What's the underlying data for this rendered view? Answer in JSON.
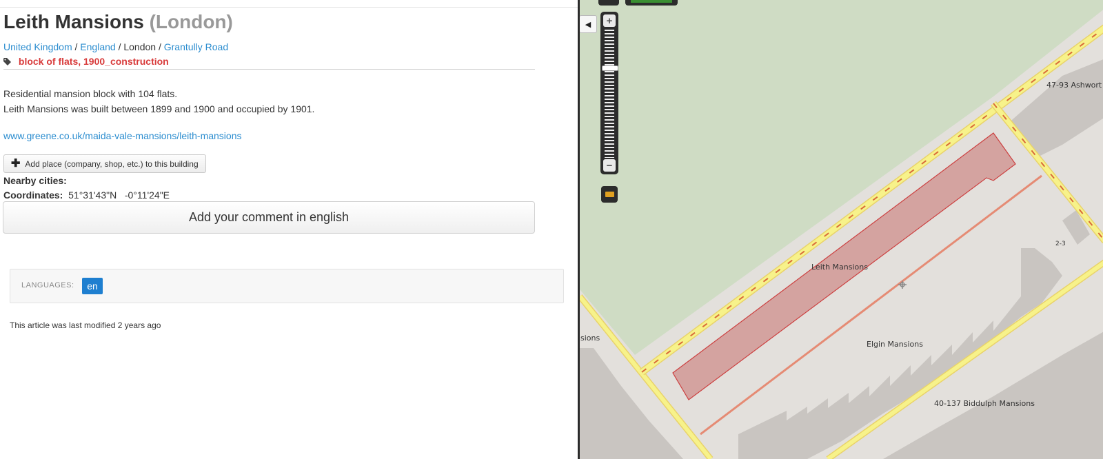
{
  "article": {
    "title": "Leith Mansions",
    "city": "(London)",
    "breadcrumb": [
      "United Kingdom",
      "England",
      "London",
      "Grantully Road"
    ],
    "tags": "block of flats, 1900_construction",
    "description_1": "Residential mansion block with 104 flats.",
    "description_2": "Leith Mansions was built between 1899 and 1900 and occupied by 1901.",
    "link": "www.greene.co.uk/maida-vale-mansions/leith-mansions",
    "add_place_label": "Add place (company, shop, etc.) to this building",
    "nearby_label": "Nearby cities:",
    "coordinates_label": "Coordinates:",
    "latitude": "51°31'43\"N",
    "longitude": "-0°11'24\"E",
    "comment_button": "Add your comment in english",
    "languages_label": "LANGUAGES:",
    "language_code": "en",
    "modified": "This article was last modified 2 years ago"
  },
  "map": {
    "labels": {
      "leith": "Leith Mansions",
      "elgin": "Elgin Mansions",
      "biddulph": "40-137 Biddulph Mansions",
      "ashworth": "47-93 Ashwort",
      "sions": "sions",
      "num": "2-3"
    },
    "colors": {
      "park": "#cfdcc4",
      "land": "#e3e0dc",
      "building": "#c9c5c1",
      "highlight": "#d4a3a0",
      "road": "#f7f28a",
      "road_edge": "#e9d36a",
      "footway": "#e58b74"
    },
    "zoom_level_fraction": 0.28
  }
}
